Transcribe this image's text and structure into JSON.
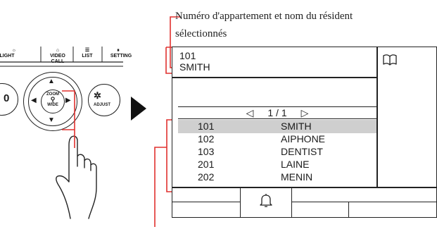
{
  "callout": {
    "line1": "Numéro d'appartement et nom du résident",
    "line2": "sélectionnés"
  },
  "device": {
    "buttons": [
      {
        "label": "LIGHT",
        "icon": "light-icon"
      },
      {
        "label": "VIDEO CALL",
        "icon": "video-call-icon"
      },
      {
        "label": "LIST",
        "icon": "list-icon"
      },
      {
        "label": "SETTING",
        "icon": "settings-icon"
      }
    ],
    "dpad": {
      "center_top": "ZOOM",
      "center_bottom": "WIDE"
    },
    "left_button": "0",
    "right_button": "ADJUST"
  },
  "screen": {
    "selected_number": "101",
    "selected_name": "SMITH",
    "book_icon": "book-icon",
    "page_prev_icon": "triangle-left-icon",
    "page": "1 / 1",
    "page_next_icon": "triangle-right-icon",
    "residents": [
      {
        "number": "101",
        "name": "SMITH",
        "selected": true
      },
      {
        "number": "102",
        "name": "AIPHONE",
        "selected": false
      },
      {
        "number": "103",
        "name": "DENTIST",
        "selected": false
      },
      {
        "number": "201",
        "name": "LAINE",
        "selected": false
      },
      {
        "number": "202",
        "name": "MENIN",
        "selected": false
      }
    ],
    "call_icon": "bell-icon"
  },
  "colors": {
    "callout_red": "#e0312f",
    "selected_row": "#cfcfcf",
    "line": "#222222"
  }
}
